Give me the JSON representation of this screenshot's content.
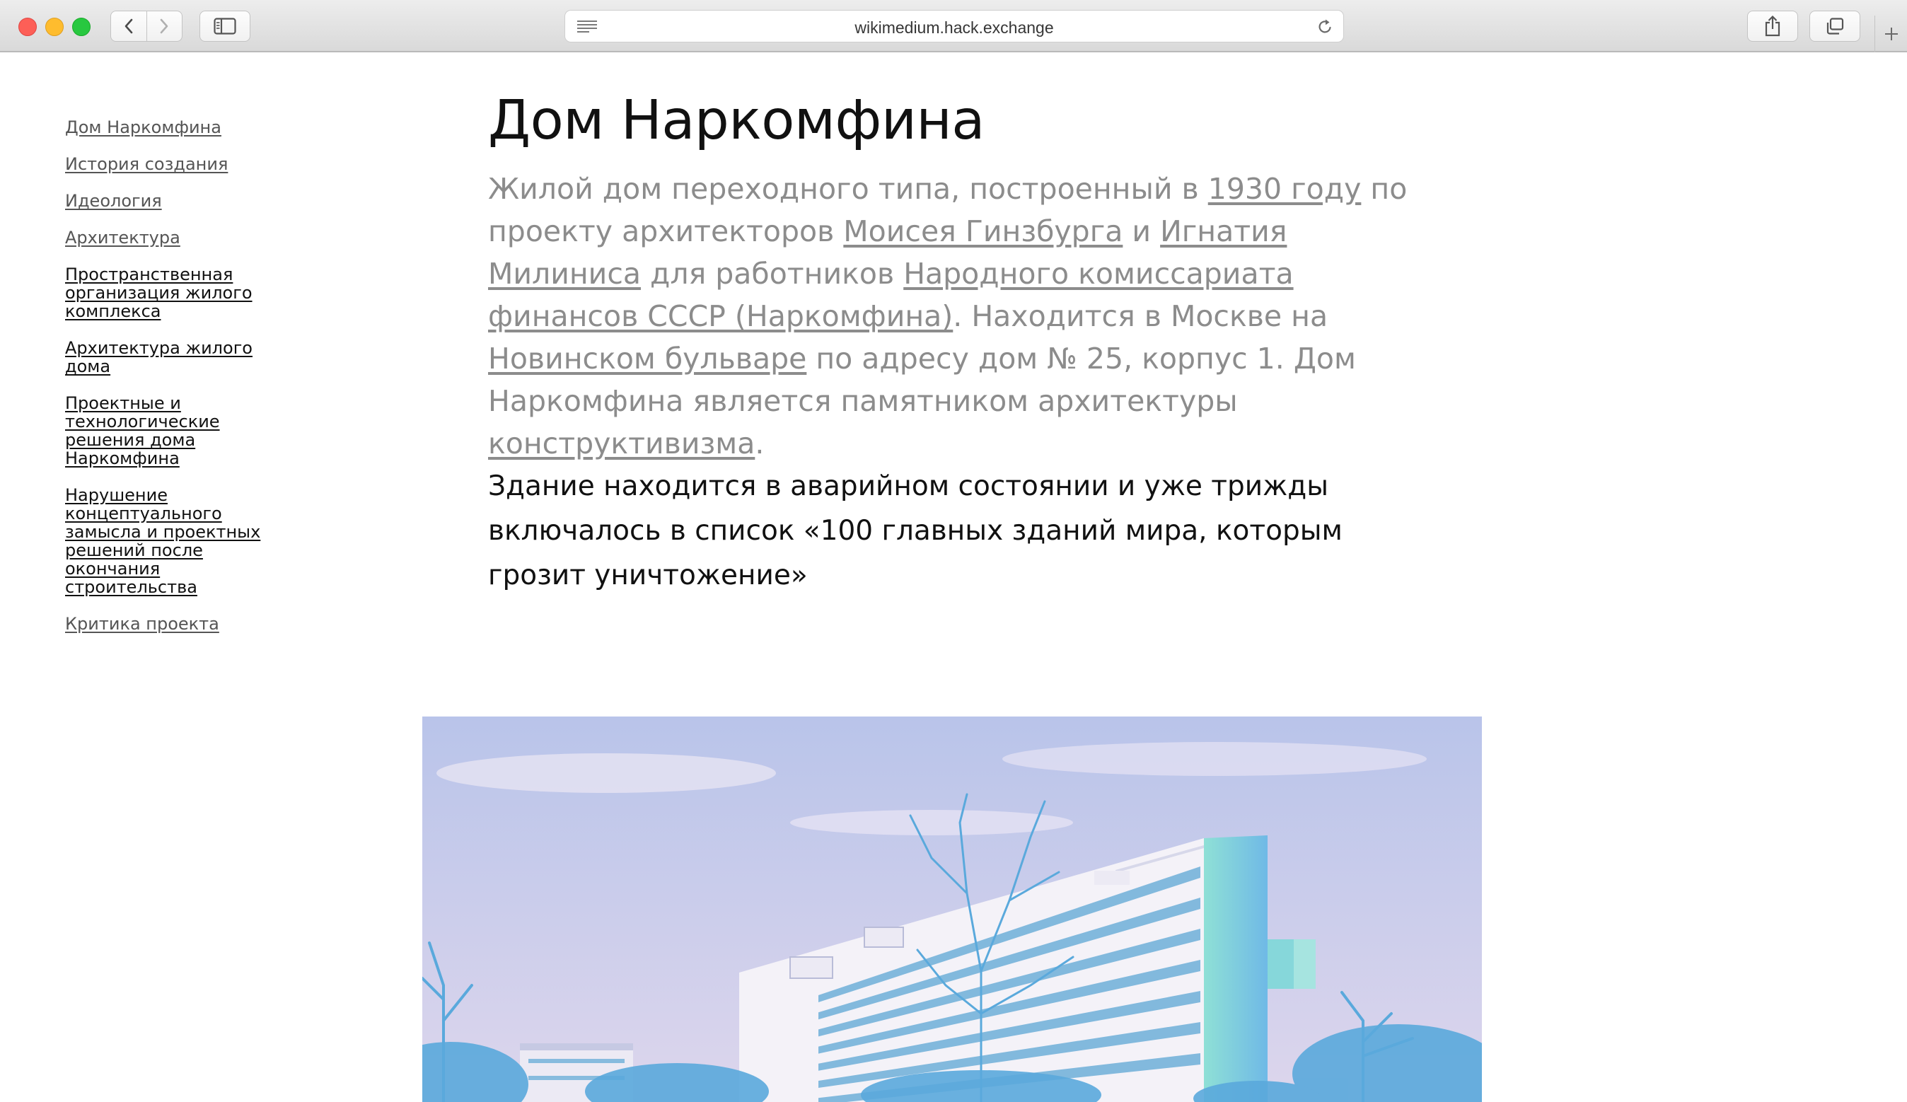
{
  "browser": {
    "url": "wikimedium.hack.exchange",
    "icons": [
      "back-icon",
      "forward-icon",
      "sidebar-icon",
      "reader-icon",
      "reload-icon",
      "share-icon",
      "tabs-icon",
      "plus-icon"
    ]
  },
  "toc": {
    "items": [
      {
        "label": "Дом Наркомфина"
      },
      {
        "label": "История создания"
      },
      {
        "label": "Идеология"
      },
      {
        "label": "Архитектура"
      },
      {
        "label": "Пространственная организация жилого комплекса"
      },
      {
        "label": "Архитектура жилого дома"
      },
      {
        "label": "Проектные и технологические решения дома Наркомфина"
      },
      {
        "label": "Нарушение концептуального замысла и проектных решений после окончания строительства"
      },
      {
        "label": "Критика проекта"
      }
    ]
  },
  "article": {
    "title": "Дом Наркомфина",
    "lead": {
      "t1": "Жилой дом переходного типа, построенный в ",
      "l1": "1930 году",
      "t2": " по проекту архитекторов ",
      "l2": "Моисея Гинзбурга",
      "t3": " и ",
      "l3": "Игнатия Милиниса",
      "t4": " для работников ",
      "l4": "Народного комиссариата финансов СССР (Наркомфина)",
      "t5": ". Находится в Москве на ",
      "l5": "Новинском бульваре",
      "t6": " по адресу дом № 25, корпус 1. Дом Наркомфина является памятником архитектуры ",
      "l6": "конструктивизма",
      "t7": "."
    },
    "quote": "Здание находится в аварийном состоянии и уже трижды включалось в список «100 главных зданий мира, которым грозит уничтожение»"
  },
  "colors": {
    "sky_top": "#b9c4ea",
    "sky_bottom": "#ddd6ec",
    "building": "#f4f2f8",
    "building_side": "#78cfd4",
    "trees": "#5aa9dc"
  }
}
